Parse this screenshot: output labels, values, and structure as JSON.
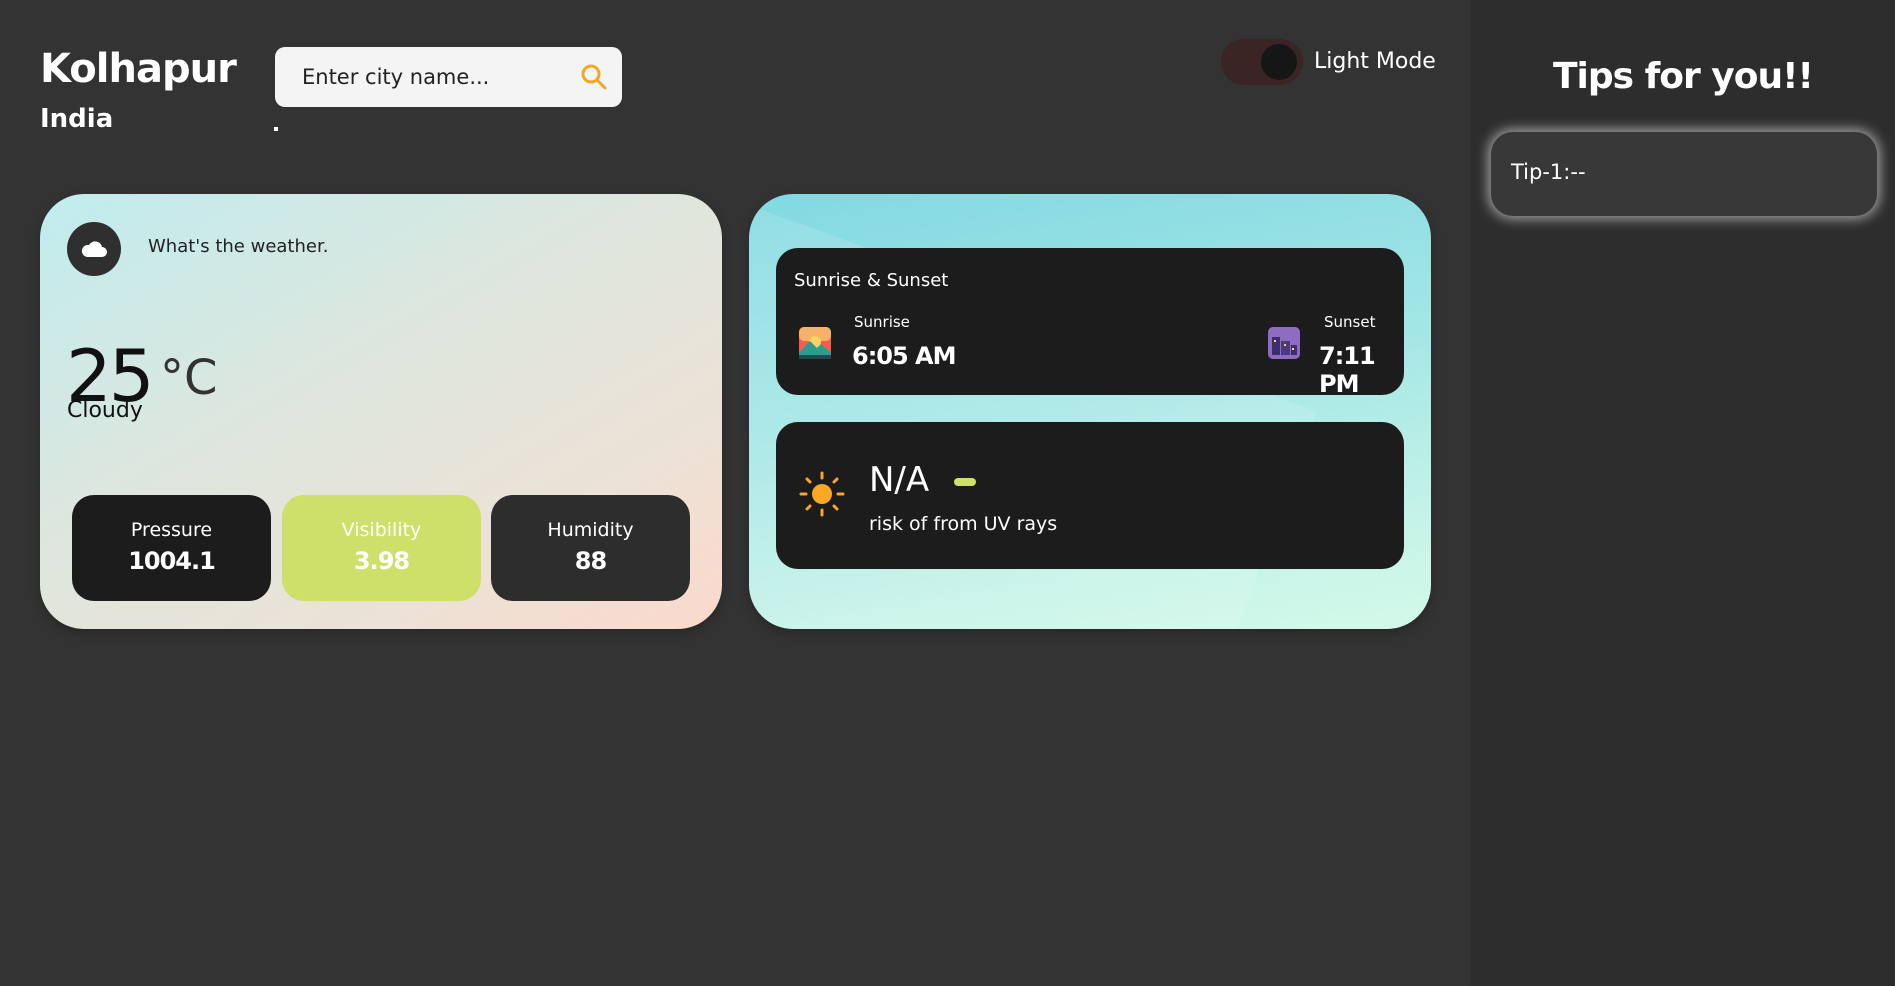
{
  "header": {
    "city": "Kolhapur",
    "country": "India",
    "search_placeholder": "Enter city name...",
    "dot": ".",
    "mode_label": "Light Mode"
  },
  "weather": {
    "question": "What's the weather.",
    "temperature": "25",
    "unit": "°C",
    "condition": "Cloudy",
    "stats": {
      "pressure_label": "Pressure",
      "pressure_value": "1004.1",
      "visibility_label": "Visibility",
      "visibility_value": "3.98",
      "humidity_label": "Humidity",
      "humidity_value": "88"
    }
  },
  "sun": {
    "title": "Sunrise & Sunset",
    "sunrise_label": "Sunrise",
    "sunrise_time": "6:05 AM",
    "sunset_label": "Sunset",
    "sunset_time": "7:11 PM"
  },
  "uv": {
    "value": "N/A",
    "text": "risk of from UV rays"
  },
  "sidebar": {
    "title": "Tips for you!!",
    "tips": [
      "Tip-1:--"
    ]
  },
  "colors": {
    "background": "#333333",
    "sidebar": "#2d2d2d",
    "accent_green": "#cfe06a",
    "search_icon": "#f5a623"
  }
}
